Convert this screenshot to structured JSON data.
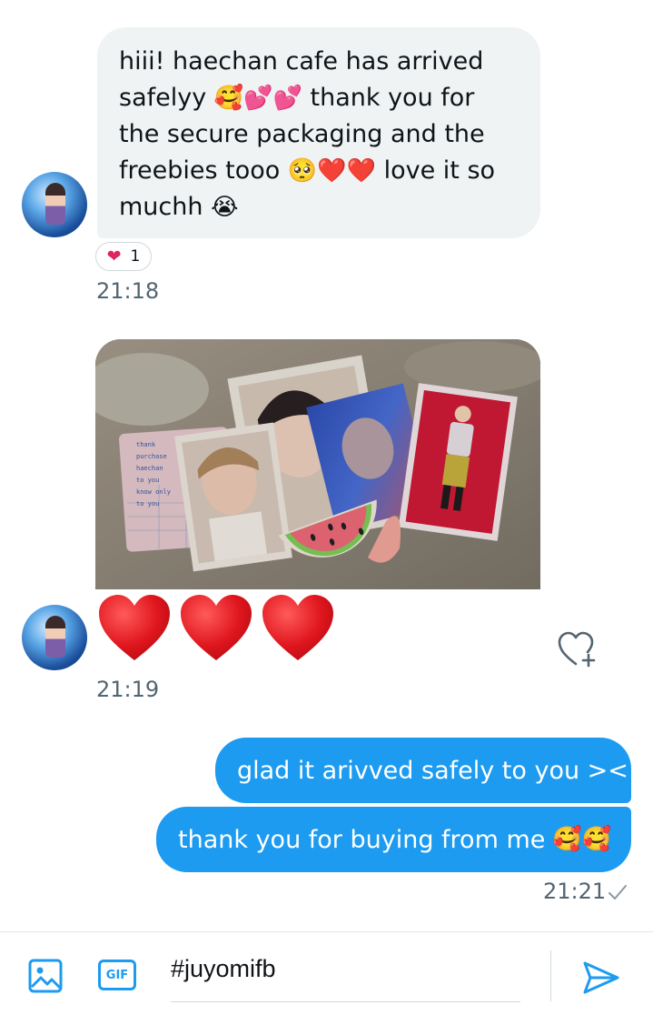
{
  "conversation": {
    "incoming": {
      "message_text_lines": [
        "hiii! haechan cafe has arrived",
        "safelyy",
        "thank you for",
        "the secure packaging and the",
        "freebies tooo",
        "love it so",
        "muchh"
      ],
      "reaction": {
        "icon": "heart-icon",
        "count": "1"
      },
      "time_1": "21:18",
      "photo_card_notes": [
        "thank",
        "purchase",
        "haechan",
        "to you",
        "know only",
        "to you"
      ],
      "time_2": "21:19"
    },
    "outgoing": {
      "message_1": "glad it arivved safely to you ><",
      "message_2": "thank you for buying from me",
      "time": "21:21"
    }
  },
  "composer": {
    "gif_label": "GIF",
    "input_value": "#juyomifb"
  },
  "colors": {
    "accent": "#1d9bf0",
    "incoming_bubble": "#eff3f4",
    "timestamp": "#536471",
    "heart": "#e0245e"
  }
}
